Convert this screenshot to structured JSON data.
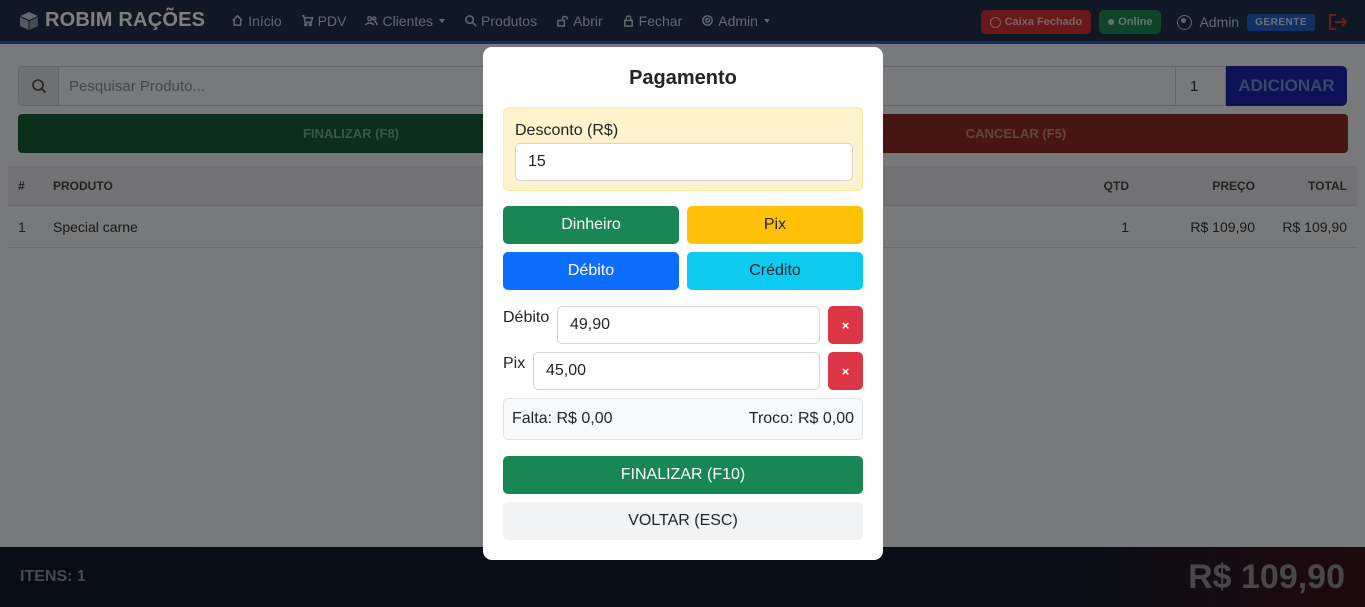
{
  "navbar": {
    "brand": "ROBIM RAÇÕES",
    "items": [
      {
        "label": "Início",
        "icon": "home-icon"
      },
      {
        "label": "PDV",
        "icon": "cart-icon"
      },
      {
        "label": "Clientes",
        "icon": "users-icon"
      },
      {
        "label": "Produtos",
        "icon": "search-icon"
      },
      {
        "label": "Abrir",
        "icon": "unlock-icon"
      },
      {
        "label": "Fechar",
        "icon": "lock-icon"
      },
      {
        "label": "Admin",
        "icon": "gear-icon"
      }
    ],
    "cash_status": "Caixa Fechado",
    "connection_status": "Online",
    "user": "Admin",
    "role": "GERENTE"
  },
  "pos": {
    "search_placeholder": "Pesquisar Produto...",
    "quantity": "1",
    "add_label": "ADICIONAR",
    "finalize_label": "FINALIZAR (F8)",
    "cancel_label": "CANCELAR (F5)",
    "table": {
      "headers": [
        "#",
        "PRODUTO",
        "QTD",
        "PREÇO",
        "TOTAL"
      ],
      "rows": [
        {
          "idx": "1",
          "product": "Special carne",
          "qty": "1",
          "price": "R$ 109,90",
          "total": "R$ 109,90"
        }
      ]
    },
    "footer": {
      "items_label": "ITENS: 1",
      "total": "R$ 109,90"
    }
  },
  "modal": {
    "title": "Pagamento",
    "discount_label": "Desconto (R$)",
    "discount_value": "15",
    "methods": {
      "cash": "Dinheiro",
      "pix": "Pix",
      "debit": "Débito",
      "credit": "Crédito"
    },
    "payments": [
      {
        "method": "Débito",
        "amount": "49,90",
        "remove": "×"
      },
      {
        "method": "Pix",
        "amount": "45,00",
        "remove": "×"
      }
    ],
    "missing": "Falta: R$ 0,00",
    "change": "Troco: R$ 0,00",
    "finalize_label": "FINALIZAR (F10)",
    "back_label": "VOLTAR (ESC)"
  },
  "colors": {
    "navbar_bg": "#212f4a",
    "success": "#198754",
    "warning": "#ffc107",
    "primary": "#0d6efd",
    "info": "#0dcaf0",
    "danger": "#dc3545",
    "discount_bg": "#fff3cd"
  }
}
